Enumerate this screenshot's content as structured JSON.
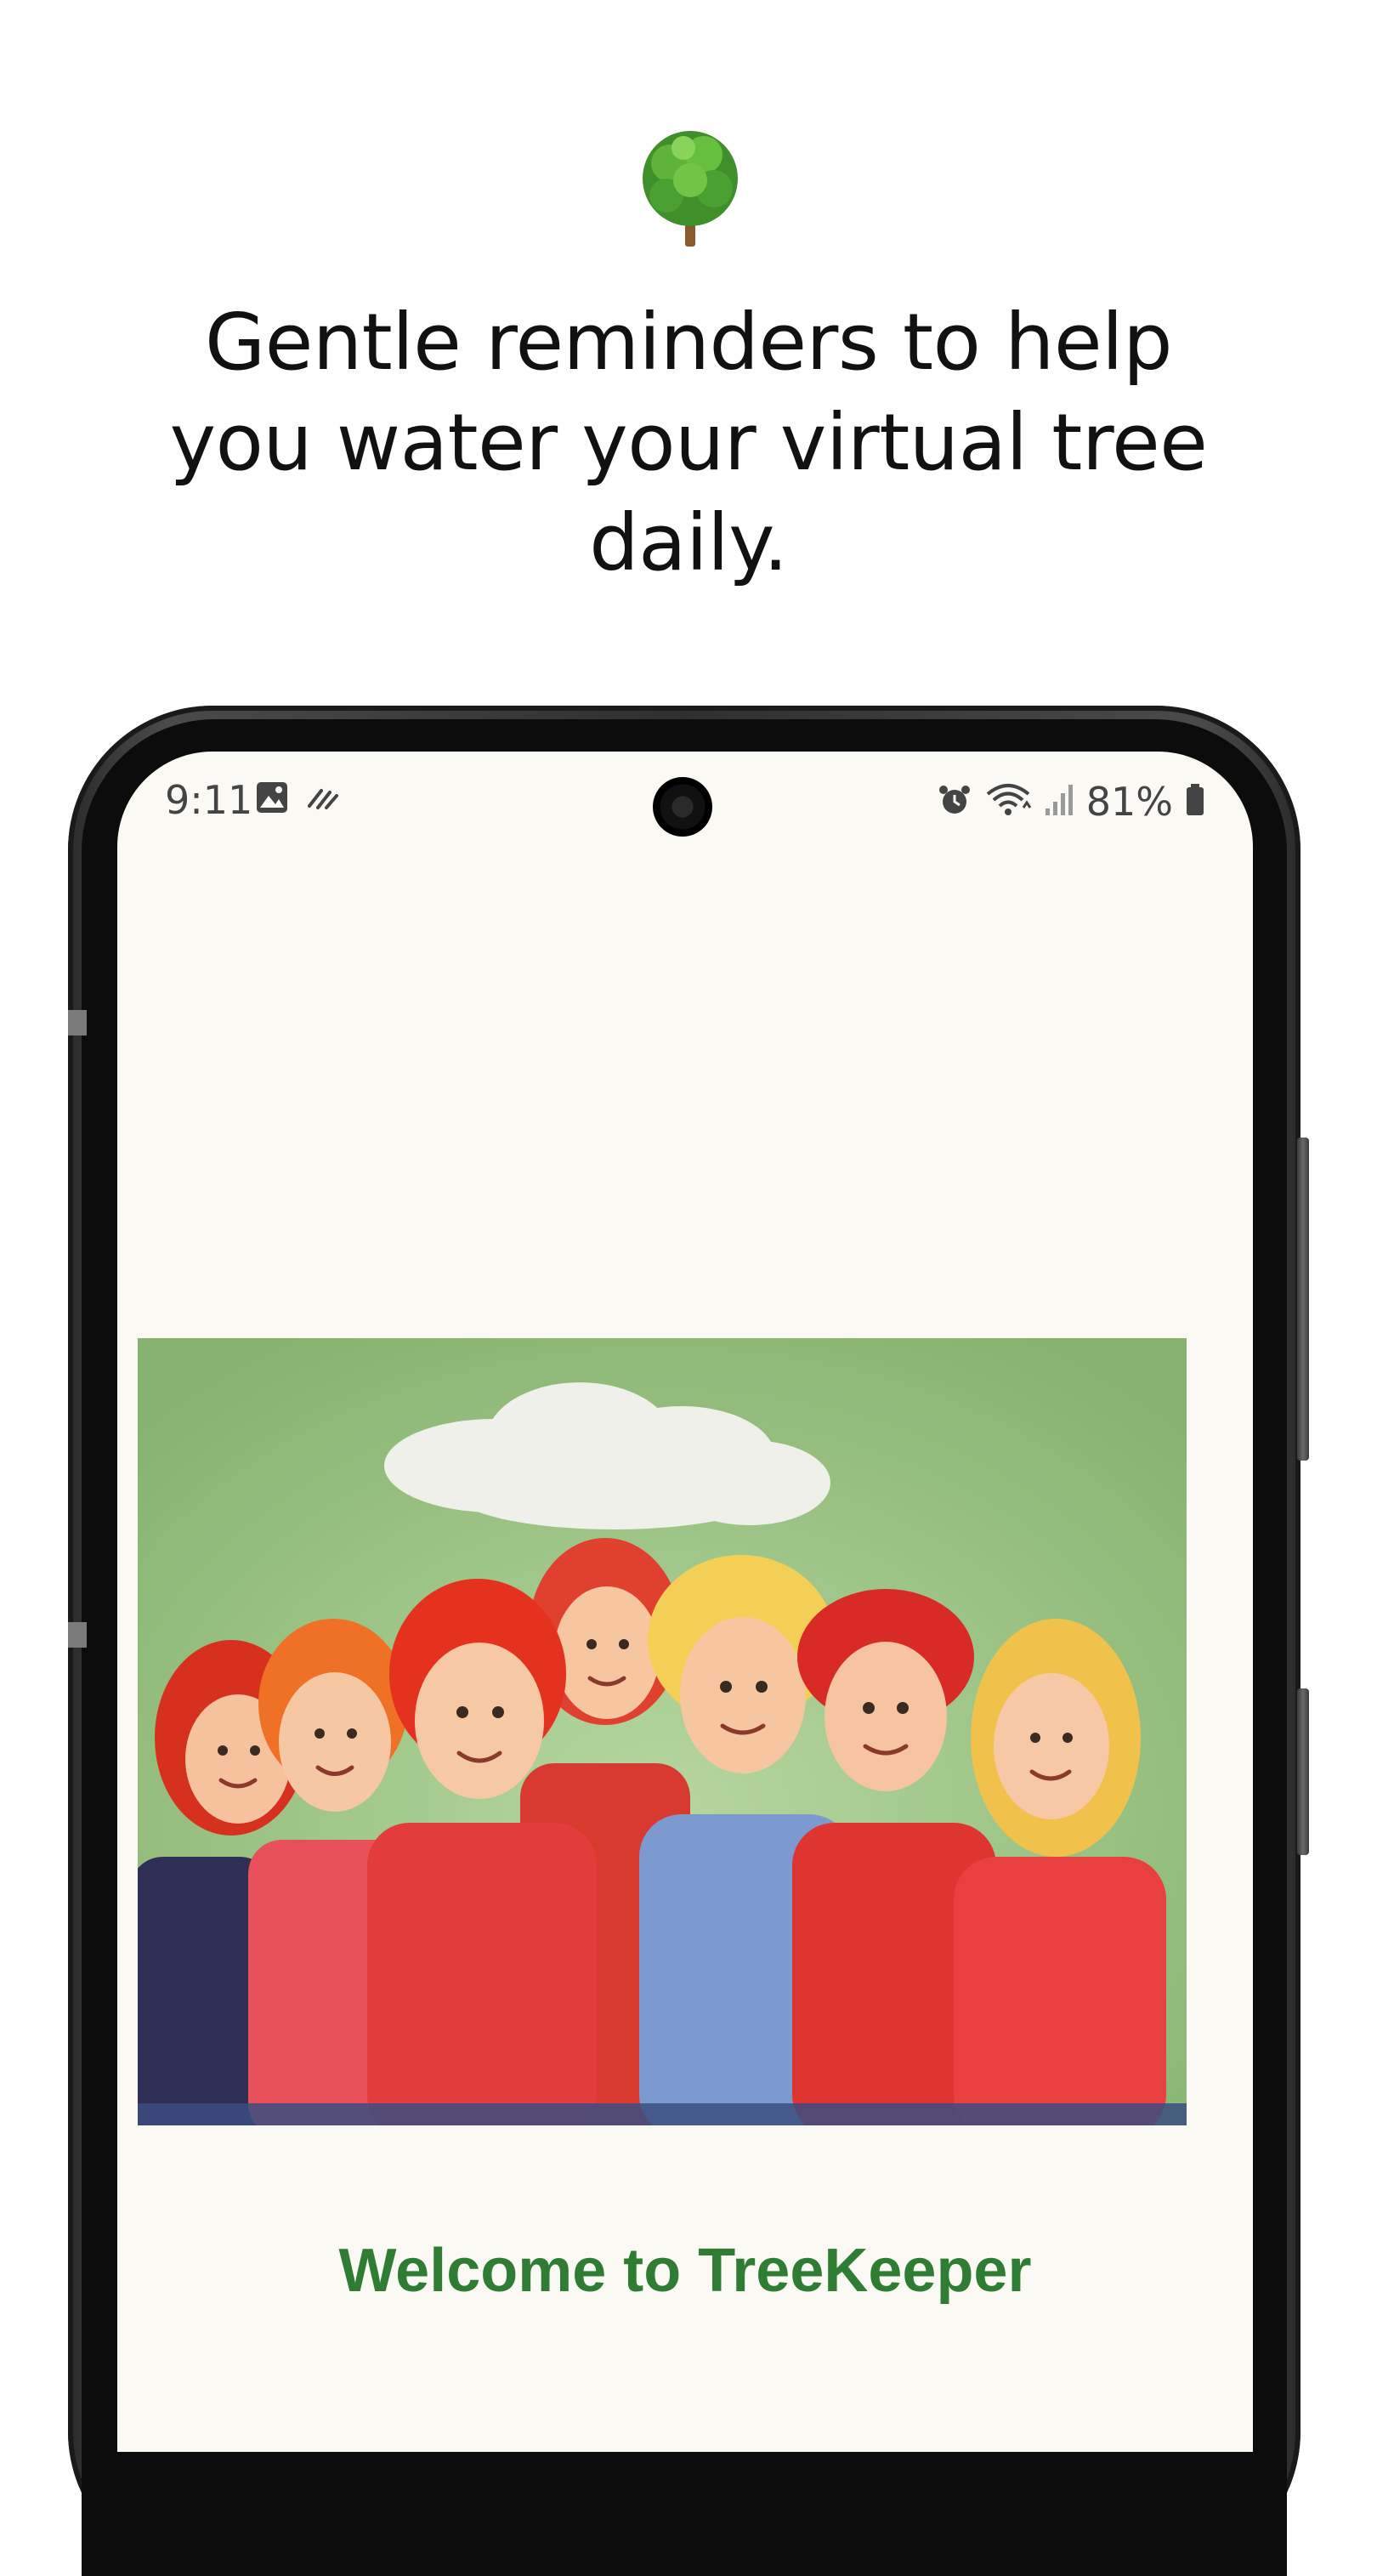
{
  "hero": {
    "icon": "tree-icon",
    "headline": "Gentle reminders to help you water your virtual tree daily."
  },
  "status_bar": {
    "time": "9:11",
    "left_icons": [
      "image-icon",
      "motion-icon"
    ],
    "right_icons": [
      "alarm-icon",
      "wifi-icon",
      "signal-icon",
      "battery-icon"
    ],
    "battery": "81%"
  },
  "screen": {
    "illustration": "group-of-people-illustration",
    "welcome_title": "Welcome to TreeKeeper"
  },
  "colors": {
    "background": "#ffffff",
    "screen_background": "#fbf9f3",
    "accent_green": "#2e7d32",
    "illustration_sky": "#8db878"
  }
}
